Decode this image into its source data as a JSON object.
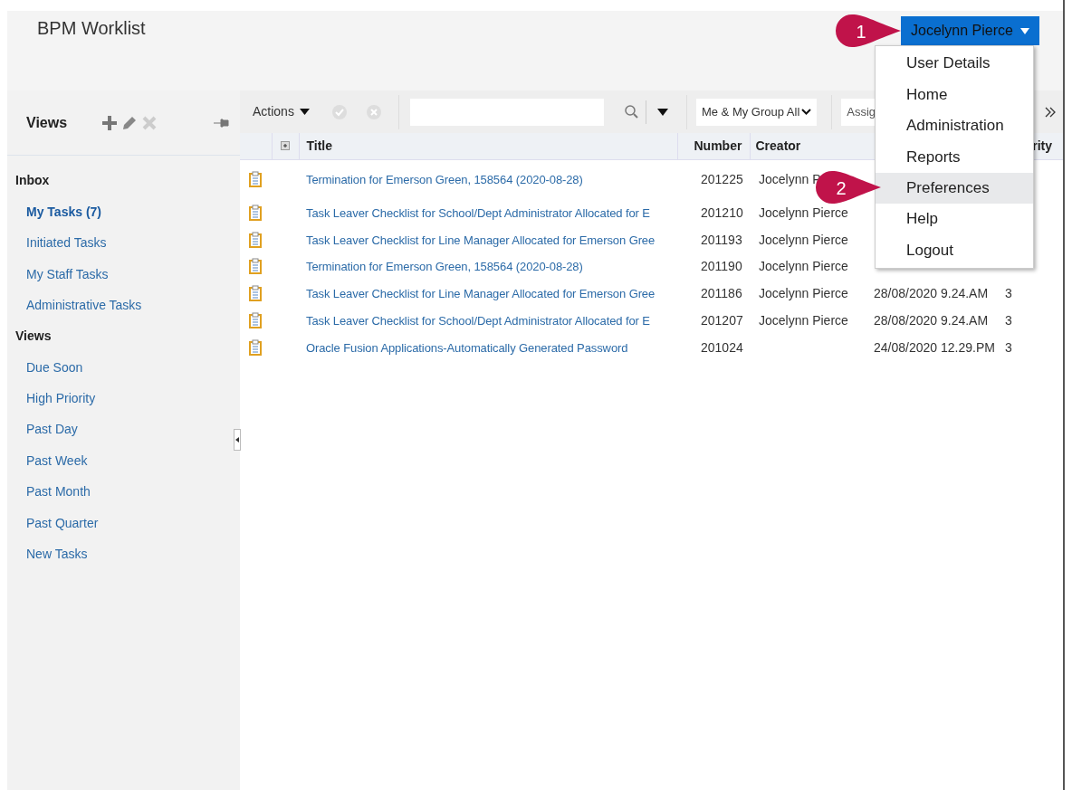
{
  "header": {
    "title": "BPM Worklist",
    "user_menu": {
      "label": "Jocelynn Pierce",
      "expanded": true,
      "items": [
        {
          "label": "User Details",
          "selected": false
        },
        {
          "label": "Home",
          "selected": false
        },
        {
          "label": "Administration",
          "selected": false
        },
        {
          "label": "Reports",
          "selected": false
        },
        {
          "label": "Preferences",
          "selected": true
        },
        {
          "label": "Help",
          "selected": false
        },
        {
          "label": "Logout",
          "selected": false
        }
      ]
    }
  },
  "callouts": [
    {
      "label": "1"
    },
    {
      "label": "2"
    }
  ],
  "sidebar": {
    "title": "Views",
    "sections": [
      {
        "heading": "Inbox",
        "items": [
          {
            "label": "My Tasks (7)",
            "selected": true
          },
          {
            "label": "Initiated Tasks",
            "selected": false
          },
          {
            "label": "My Staff Tasks",
            "selected": false
          },
          {
            "label": "Administrative Tasks",
            "selected": false
          }
        ]
      },
      {
        "heading": "Views",
        "items": [
          {
            "label": "Due Soon",
            "selected": false
          },
          {
            "label": "High Priority",
            "selected": false
          },
          {
            "label": "Past Day",
            "selected": false
          },
          {
            "label": "Past Week",
            "selected": false
          },
          {
            "label": "Past Month",
            "selected": false
          },
          {
            "label": "Past Quarter",
            "selected": false
          },
          {
            "label": "New Tasks",
            "selected": false
          }
        ]
      }
    ]
  },
  "toolbar": {
    "actions_label": "Actions",
    "filter_label": "Me & My Group All",
    "second_filter": "Assig"
  },
  "table": {
    "columns": [
      "Title",
      "Number",
      "Creator",
      "rity"
    ],
    "rows": [
      {
        "title": "Termination for Emerson Green, 158564 (2020-08-28)",
        "number": "201225",
        "creator": "Jocelynn P"
      },
      {
        "title": "Task Leaver Checklist for School/Dept Administrator Allocated for E",
        "number": "201210",
        "creator": "Jocelynn Pierce"
      },
      {
        "title": "Task Leaver Checklist for Line Manager Allocated for Emerson Gree",
        "number": "201193",
        "creator": "Jocelynn Pierce"
      },
      {
        "title": "Termination for Emerson Green, 158564 (2020-08-28)",
        "number": "201190",
        "creator": "Jocelynn Pierce"
      },
      {
        "title": "Task Leaver Checklist for Line Manager Allocated for Emerson Gree",
        "number": "201186",
        "creator": "Jocelynn Pierce",
        "assigned": "28/08/2020 9.24.AM",
        "priority": "3"
      },
      {
        "title": "Task Leaver Checklist for School/Dept Administrator Allocated for E",
        "number": "201207",
        "creator": "Jocelynn Pierce",
        "assigned": "28/08/2020 9.24.AM",
        "priority": "3"
      },
      {
        "title": "Oracle Fusion Applications-Automatically Generated Password",
        "number": "201024",
        "assigned": "24/08/2020 12.29.PM",
        "priority": "3"
      }
    ]
  }
}
